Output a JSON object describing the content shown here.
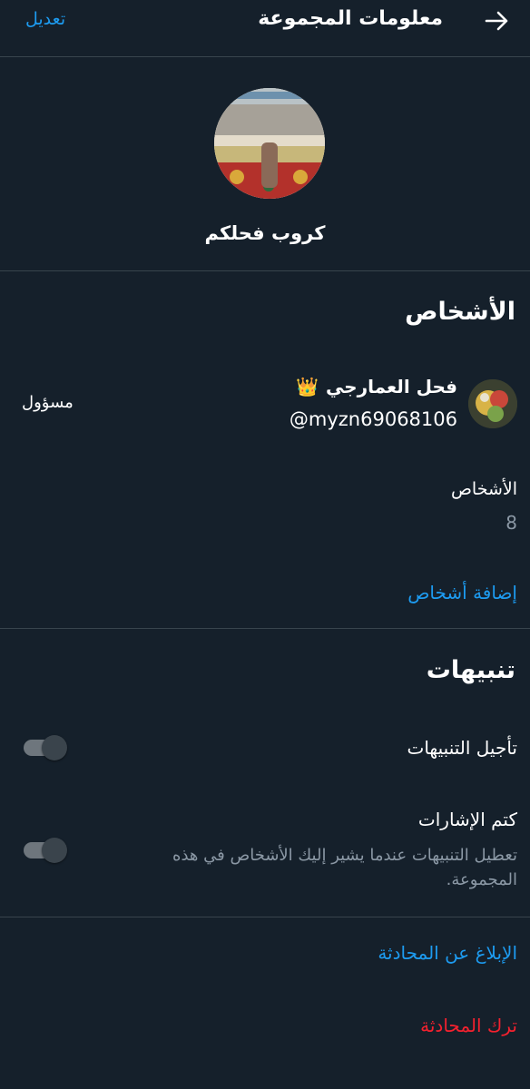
{
  "header": {
    "title": "معلومات المجموعة",
    "edit_label": "تعديل",
    "back_icon": "arrow-right-icon"
  },
  "group": {
    "name": "كروب فحلكم",
    "avatar_icon": "group-photo"
  },
  "people": {
    "section_title": "الأشخاص",
    "admin": {
      "name": "فحل العمارجي",
      "emoji": "👑",
      "handle": "@myzn69068106",
      "role": "مسؤول"
    },
    "count_label": "الأشخاص",
    "count_value": "8",
    "add_label": "إضافة أشخاص"
  },
  "notifications": {
    "section_title": "تنبيهات",
    "snooze": {
      "label": "تأجيل التنبيهات",
      "on": false
    },
    "mute_mentions": {
      "label": "كتم الإشارات",
      "description": "تعطيل التنبيهات عندما يشير إليك الأشخاص في هذه المجموعة.",
      "on": false
    }
  },
  "actions": {
    "report_label": "الإبلاغ عن المحادثة",
    "leave_label": "ترك المحادثة"
  },
  "colors": {
    "background": "#15202b",
    "accent": "#1d9bf0",
    "danger": "#f4212e",
    "divider": "#38444d",
    "secondary_text": "#8b98a5"
  }
}
